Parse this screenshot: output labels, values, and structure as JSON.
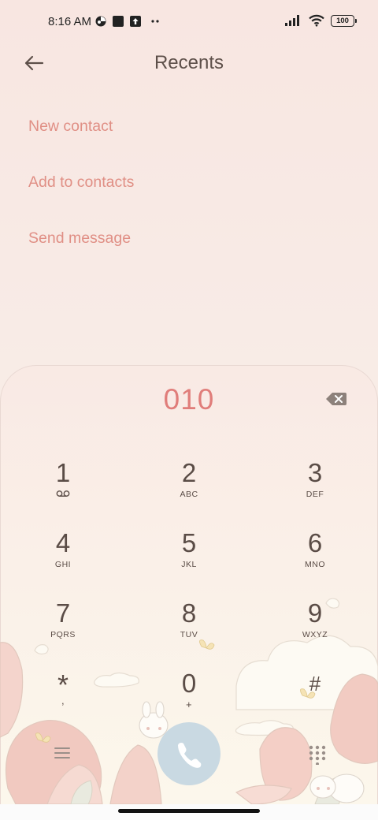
{
  "status_bar": {
    "time": "8:16 AM",
    "battery": "100",
    "icons": [
      "notification-icon",
      "square-icon",
      "upload-icon",
      "more-dots-icon",
      "signal-icon",
      "wifi-icon",
      "battery-icon"
    ]
  },
  "header": {
    "title": "Recents",
    "back_icon": "back-arrow-icon"
  },
  "options": [
    {
      "label": "New contact"
    },
    {
      "label": "Add to contacts"
    },
    {
      "label": "Send message"
    }
  ],
  "dialer": {
    "number": "010",
    "keys": [
      {
        "digit": "1",
        "letters": ""
      },
      {
        "digit": "2",
        "letters": "ABC"
      },
      {
        "digit": "3",
        "letters": "DEF"
      },
      {
        "digit": "4",
        "letters": "GHI"
      },
      {
        "digit": "5",
        "letters": "JKL"
      },
      {
        "digit": "6",
        "letters": "MNO"
      },
      {
        "digit": "7",
        "letters": "PQRS"
      },
      {
        "digit": "8",
        "letters": "TUV"
      },
      {
        "digit": "9",
        "letters": "WXYZ"
      },
      {
        "digit": "*",
        "letters": ","
      },
      {
        "digit": "0",
        "letters": "+"
      },
      {
        "digit": "#",
        "letters": ""
      }
    ]
  },
  "colors": {
    "accent": "#e08f85",
    "number": "#e07d7a",
    "call_button": "#c9d9e2"
  }
}
